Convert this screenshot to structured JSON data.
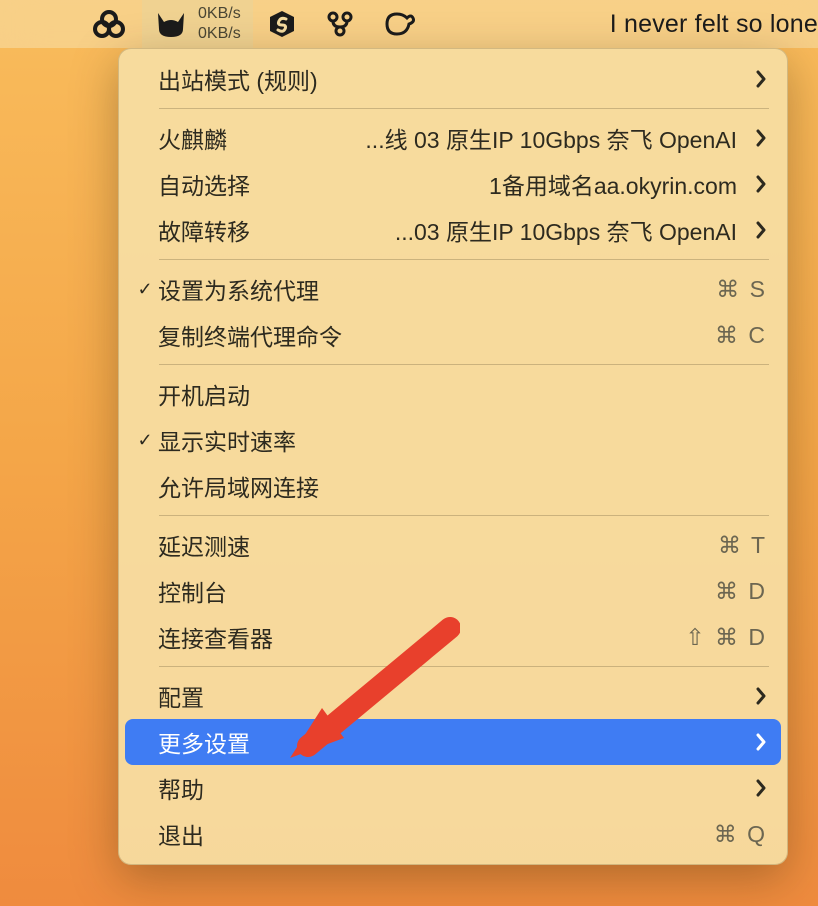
{
  "menubar": {
    "stats": {
      "up": "0KB/s",
      "down": "0KB/s"
    },
    "title": "I never felt so lone"
  },
  "menu": {
    "outbound_mode": "出站模式 (规则)",
    "profile_huo": {
      "label": "火麒麟",
      "detail": "...线 03 原生IP 10Gbps 奈飞 OpenAI"
    },
    "profile_auto": {
      "label": "自动选择",
      "detail": "1备用域名aa.okyrin.com"
    },
    "profile_fail": {
      "label": "故障转移",
      "detail": "...03 原生IP 10Gbps 奈飞 OpenAI"
    },
    "system_proxy": {
      "label": "设置为系统代理",
      "shortcut": "⌘ S"
    },
    "copy_terminal": {
      "label": "复制终端代理命令",
      "shortcut": "⌘ C"
    },
    "start_on_boot": "开机启动",
    "show_speed": "显示实时速率",
    "allow_lan": "允许局域网连接",
    "latency": {
      "label": "延迟测速",
      "shortcut": "⌘ T"
    },
    "console": {
      "label": "控制台",
      "shortcut": "⌘ D"
    },
    "conn_viewer": {
      "label": "连接查看器",
      "shortcut": "⇧ ⌘ D"
    },
    "config": "配置",
    "more_settings": "更多设置",
    "help": "帮助",
    "quit": {
      "label": "退出",
      "shortcut": "⌘ Q"
    }
  }
}
